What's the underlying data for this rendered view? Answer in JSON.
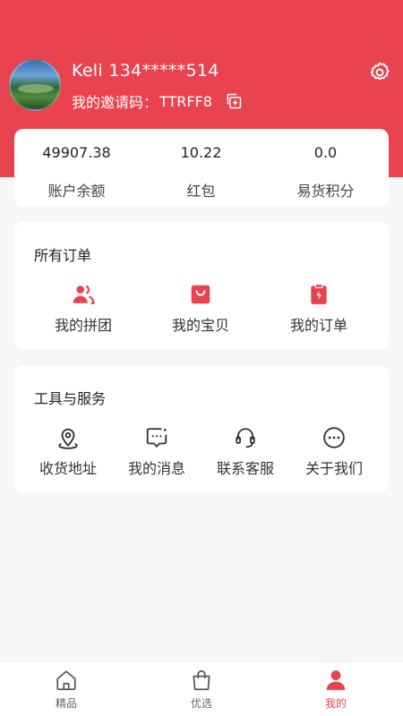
{
  "profile": {
    "name": "Keli",
    "phone": "134*****514",
    "invite_label": "我的邀请码：",
    "invite_code": "TTRFF8"
  },
  "wallet": [
    {
      "value": "49907.38",
      "label": "账户余额"
    },
    {
      "value": "10.22",
      "label": "红包"
    },
    {
      "value": "0.0",
      "label": "易货积分"
    }
  ],
  "orders": {
    "title": "所有订单",
    "items": [
      {
        "label": "我的拼团",
        "icon": "group-users-icon"
      },
      {
        "label": "我的宝贝",
        "icon": "shopping-bag-icon"
      },
      {
        "label": "我的订单",
        "icon": "order-clipboard-icon"
      }
    ]
  },
  "services": {
    "title": "工具与服务",
    "items": [
      {
        "label": "收货地址",
        "icon": "location-pin-icon"
      },
      {
        "label": "我的消息",
        "icon": "message-icon"
      },
      {
        "label": "联系客服",
        "icon": "headset-icon"
      },
      {
        "label": "关于我们",
        "icon": "more-dots-icon"
      }
    ]
  },
  "tabbar": [
    {
      "label": "精品",
      "icon": "home-icon",
      "active": false
    },
    {
      "label": "优选",
      "icon": "bag-icon",
      "active": false
    },
    {
      "label": "我的",
      "icon": "person-icon",
      "active": true
    }
  ],
  "colors": {
    "accent": "#e9434f",
    "background": "#f7f7f7"
  }
}
